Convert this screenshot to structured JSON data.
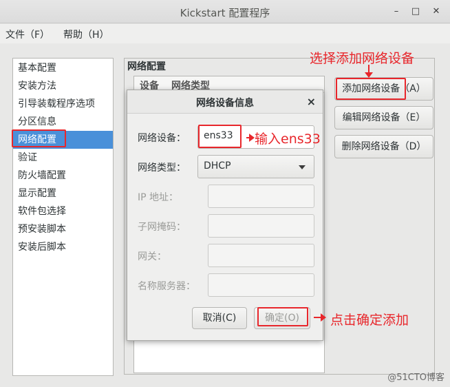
{
  "window": {
    "title": "Kickstart 配置程序",
    "minimize": "–",
    "maximize": "□",
    "close": "✕"
  },
  "menu": [
    "文件（F）",
    "帮助（H）"
  ],
  "sidebar": {
    "items": [
      "基本配置",
      "安装方法",
      "引导装载程序选项",
      "分区信息",
      "网络配置",
      "验证",
      "防火墙配置",
      "显示配置",
      "软件包选择",
      "预安装脚本",
      "安装后脚本"
    ],
    "selected_index": 4
  },
  "section": {
    "title": "网络配置",
    "table_headers": [
      "设备",
      "网络类型"
    ],
    "buttons": {
      "add": "添加网络设备（A）",
      "edit": "编辑网络设备（E）",
      "delete": "删除网络设备（D）"
    }
  },
  "dialog": {
    "title": "网络设备信息",
    "close": "×",
    "device_label": "网络设备：",
    "device_value": "ens33",
    "type_label": "网络类型：",
    "type_value": "DHCP",
    "ip_label": "IP 地址：",
    "mask_label": "子网掩码：",
    "gateway_label": "网关：",
    "dns_label": "名称服务器：",
    "cancel": "取消(C)",
    "ok": "确定(O)"
  },
  "annotations": {
    "top": "选择添加网络设备",
    "input": "输入ens33",
    "confirm": "点击确定添加",
    "color": "#e8262b"
  },
  "watermark": "@51CTO博客"
}
